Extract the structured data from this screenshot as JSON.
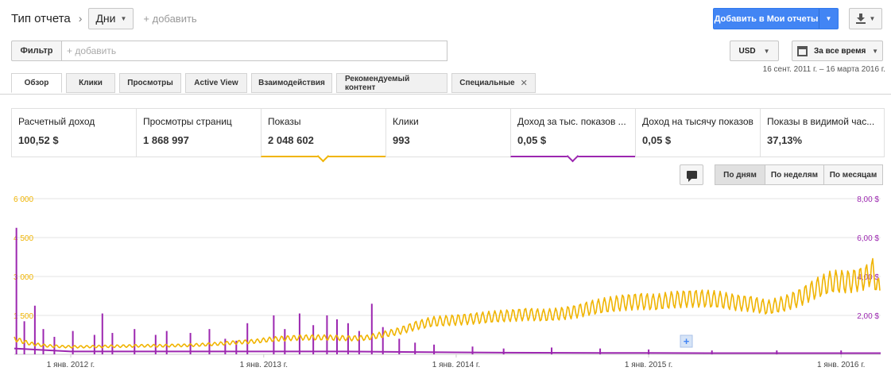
{
  "header": {
    "title": "Тип отчета",
    "breadcrumb_sep": "›",
    "granularity": "Дни",
    "add": "+ добавить",
    "add_to_reports": "Добавить в Мои отчеты"
  },
  "filter": {
    "label": "Фильтр",
    "placeholder": "+ добавить"
  },
  "currency": "USD",
  "period": "За все время",
  "date_range": "16 сент. 2011 г. – 16 марта 2016 г.",
  "tabs": [
    {
      "label": "Обзор",
      "active": true
    },
    {
      "label": "Клики"
    },
    {
      "label": "Просмотры"
    },
    {
      "label": "Active View"
    },
    {
      "label": "Взаимодействия"
    },
    {
      "label": "Рекомендуемый контент"
    },
    {
      "label": "Специальные",
      "closable": true
    }
  ],
  "metrics": [
    {
      "name": "Расчетный доход",
      "value": "100,52 $"
    },
    {
      "name": "Просмотры страниц",
      "value": "1 868 997"
    },
    {
      "name": "Показы",
      "value": "2 048 602",
      "selected": "orange"
    },
    {
      "name": "Клики",
      "value": "993"
    },
    {
      "name": "Доход за тыс. показов ...",
      "value": "0,05 $",
      "selected": "purple"
    },
    {
      "name": "Доход на тысячу показов",
      "value": "0,05 $"
    },
    {
      "name": "Показы в видимой час...",
      "value": "37,13%"
    }
  ],
  "granularity_buttons": [
    {
      "label": "По дням",
      "active": true
    },
    {
      "label": "По неделям"
    },
    {
      "label": "По месяцам"
    }
  ],
  "chart_data": {
    "type": "line",
    "x_range": [
      "2011-09-16",
      "2016-03-16"
    ],
    "x_ticks": [
      {
        "date": "2012-01-01",
        "label": "1 янв. 2012 г."
      },
      {
        "date": "2013-01-01",
        "label": "1 янв. 2013 г."
      },
      {
        "date": "2014-01-01",
        "label": "1 янв. 2014 г."
      },
      {
        "date": "2015-01-01",
        "label": "1 янв. 2015 г."
      },
      {
        "date": "2016-01-01",
        "label": "1 янв. 2016 г."
      }
    ],
    "y_left": {
      "ticks": [
        "6 000",
        "4 500",
        "3 000",
        "1 500"
      ],
      "ylim": [
        0,
        6000
      ]
    },
    "y_right": {
      "ticks": [
        "8,00 $",
        "6,00 $",
        "4,00 $",
        "2,00 $"
      ],
      "ylim": [
        0,
        8
      ]
    },
    "grid": true,
    "series": [
      {
        "color": "#f0b400",
        "axis": "left",
        "points": [
          [
            "2011-09-16",
            600
          ],
          [
            "2011-10-15",
            420
          ],
          [
            "2011-11-15",
            330
          ],
          [
            "2011-12-15",
            300
          ],
          [
            "2012-01-15",
            290
          ],
          [
            "2012-02-15",
            300
          ],
          [
            "2012-03-15",
            310
          ],
          [
            "2012-04-15",
            320
          ],
          [
            "2012-05-15",
            330
          ],
          [
            "2012-06-15",
            330
          ],
          [
            "2012-07-15",
            340
          ],
          [
            "2012-08-15",
            350
          ],
          [
            "2012-09-15",
            380
          ],
          [
            "2012-10-15",
            420
          ],
          [
            "2012-11-15",
            470
          ],
          [
            "2012-12-15",
            500
          ],
          [
            "2013-01-15",
            580
          ],
          [
            "2013-02-15",
            620
          ],
          [
            "2013-03-15",
            650
          ],
          [
            "2013-04-15",
            650
          ],
          [
            "2013-05-15",
            640
          ],
          [
            "2013-06-15",
            620
          ],
          [
            "2013-07-15",
            640
          ],
          [
            "2013-08-15",
            760
          ],
          [
            "2013-09-15",
            900
          ],
          [
            "2013-10-15",
            1100
          ],
          [
            "2013-11-15",
            1250
          ],
          [
            "2013-12-15",
            1300
          ],
          [
            "2014-01-15",
            1350
          ],
          [
            "2014-02-15",
            1400
          ],
          [
            "2014-03-15",
            1450
          ],
          [
            "2014-04-15",
            1500
          ],
          [
            "2014-05-15",
            1550
          ],
          [
            "2014-06-15",
            1500
          ],
          [
            "2014-07-15",
            1550
          ],
          [
            "2014-08-15",
            1650
          ],
          [
            "2014-09-15",
            1800
          ],
          [
            "2014-10-15",
            1900
          ],
          [
            "2014-11-15",
            2000
          ],
          [
            "2014-12-15",
            2050
          ],
          [
            "2015-01-15",
            2000
          ],
          [
            "2015-02-15",
            2100
          ],
          [
            "2015-03-15",
            2150
          ],
          [
            "2015-04-15",
            2150
          ],
          [
            "2015-05-15",
            2100
          ],
          [
            "2015-06-15",
            2000
          ],
          [
            "2015-07-15",
            1950
          ],
          [
            "2015-08-15",
            1800
          ],
          [
            "2015-09-15",
            1950
          ],
          [
            "2015-10-15",
            2200
          ],
          [
            "2015-11-15",
            2550
          ],
          [
            "2015-12-15",
            2800
          ],
          [
            "2016-01-15",
            2800
          ],
          [
            "2016-02-15",
            2950
          ],
          [
            "2016-03-01",
            3200
          ],
          [
            "2016-03-16",
            2300
          ]
        ]
      },
      {
        "color": "#9c27b0",
        "axis": "right",
        "points": [
          [
            "2011-09-16",
            0.3
          ],
          [
            "2012-01-01",
            0.15
          ],
          [
            "2012-06-01",
            0.15
          ],
          [
            "2013-01-01",
            0.15
          ],
          [
            "2013-06-01",
            0.15
          ],
          [
            "2014-01-01",
            0.1
          ],
          [
            "2014-06-01",
            0.08
          ],
          [
            "2015-01-01",
            0.07
          ],
          [
            "2015-06-01",
            0.06
          ],
          [
            "2016-01-01",
            0.06
          ],
          [
            "2016-03-16",
            0.06
          ]
        ],
        "spikes": [
          [
            "2011-09-20",
            6.5
          ],
          [
            "2011-10-05",
            1.7
          ],
          [
            "2011-10-25",
            2.5
          ],
          [
            "2011-11-10",
            1.3
          ],
          [
            "2011-12-01",
            0.9
          ],
          [
            "2012-01-05",
            1.2
          ],
          [
            "2012-02-15",
            1.0
          ],
          [
            "2012-03-01",
            2.1
          ],
          [
            "2012-03-20",
            1.1
          ],
          [
            "2012-05-01",
            1.3
          ],
          [
            "2012-06-10",
            1.0
          ],
          [
            "2012-07-01",
            1.2
          ],
          [
            "2012-08-15",
            1.1
          ],
          [
            "2012-09-20",
            1.3
          ],
          [
            "2012-10-20",
            0.8
          ],
          [
            "2012-11-10",
            0.7
          ],
          [
            "2012-12-01",
            1.6
          ],
          [
            "2013-01-20",
            2.0
          ],
          [
            "2013-02-10",
            1.3
          ],
          [
            "2013-03-10",
            2.1
          ],
          [
            "2013-04-05",
            1.5
          ],
          [
            "2013-05-01",
            2.0
          ],
          [
            "2013-05-20",
            1.8
          ],
          [
            "2013-06-10",
            1.6
          ],
          [
            "2013-07-01",
            1.2
          ],
          [
            "2013-07-25",
            2.6
          ],
          [
            "2013-08-15",
            1.4
          ],
          [
            "2013-09-15",
            0.8
          ],
          [
            "2013-10-15",
            0.6
          ],
          [
            "2013-11-20",
            0.5
          ],
          [
            "2014-02-01",
            0.4
          ],
          [
            "2014-04-01",
            0.3
          ],
          [
            "2014-07-01",
            0.35
          ],
          [
            "2014-10-01",
            0.3
          ],
          [
            "2015-01-01",
            0.25
          ],
          [
            "2015-05-01",
            0.2
          ],
          [
            "2015-09-01",
            0.2
          ],
          [
            "2016-01-01",
            0.2
          ]
        ]
      }
    ]
  }
}
